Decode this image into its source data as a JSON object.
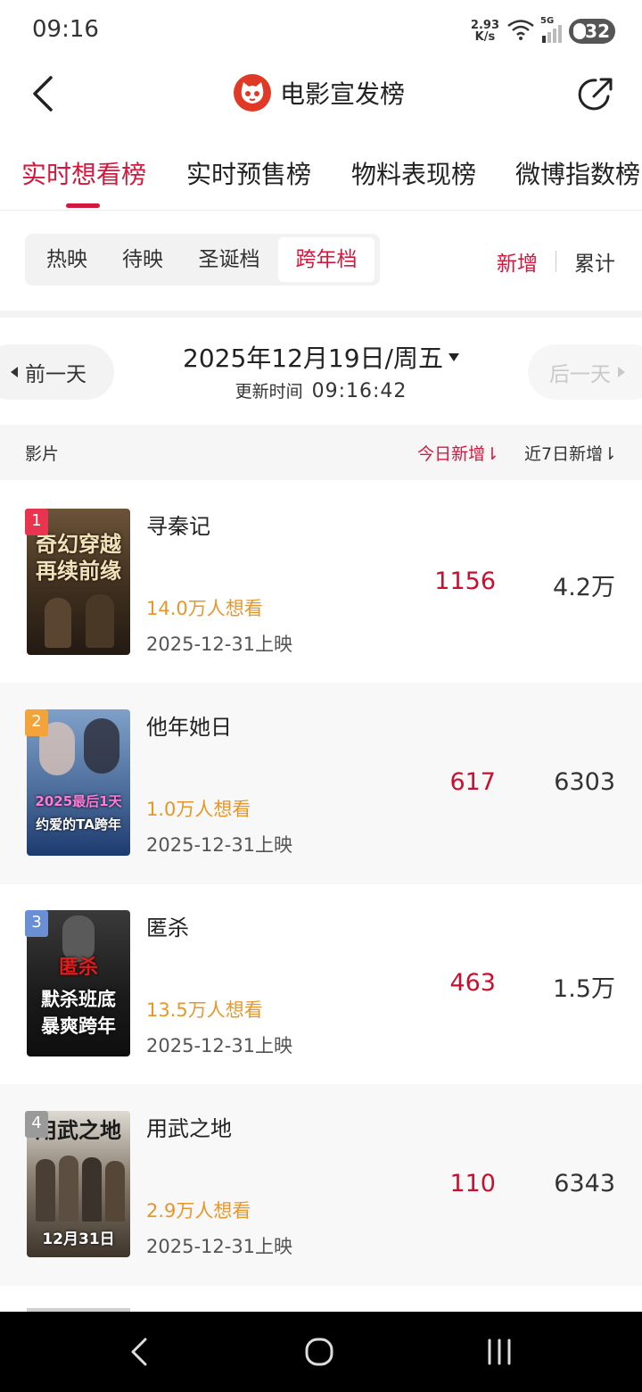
{
  "status": {
    "time": "09:16",
    "net_speed_value": "2.93",
    "net_speed_unit": "K/s",
    "signal_label": "5G",
    "battery": "32"
  },
  "header": {
    "title": "电影宣发榜"
  },
  "top_tabs": [
    {
      "label": "实时想看榜",
      "active": true
    },
    {
      "label": "实时预售榜",
      "active": false
    },
    {
      "label": "物料表现榜",
      "active": false
    },
    {
      "label": "微博指数榜",
      "active": false
    }
  ],
  "segments": [
    {
      "label": "热映",
      "active": false
    },
    {
      "label": "待映",
      "active": false
    },
    {
      "label": "圣诞档",
      "active": false
    },
    {
      "label": "跨年档",
      "active": true
    }
  ],
  "mode_toggle": {
    "new": "新增",
    "total": "累计"
  },
  "date_nav": {
    "prev": "前一天",
    "date": "2025年12月19日/周五",
    "next": "后一天",
    "update_label": "更新时间",
    "update_time": "09:16:42"
  },
  "table_header": {
    "film": "影片",
    "today": "今日新增⇂",
    "week": "近7日新增⇂"
  },
  "movies": [
    {
      "rank": "1",
      "title": "寻秦记",
      "want": "14.0万人想看",
      "release": "2025-12-31上映",
      "today": "1156",
      "week": "4.2万",
      "poster_lines": [
        "奇幻穿越",
        "再续前缘"
      ]
    },
    {
      "rank": "2",
      "title": "他年她日",
      "want": "1.0万人想看",
      "release": "2025-12-31上映",
      "today": "617",
      "week": "6303",
      "poster_lines": [
        "2025最后1天",
        "约爱的TA跨年"
      ]
    },
    {
      "rank": "3",
      "title": "匿杀",
      "want": "13.5万人想看",
      "release": "2025-12-31上映",
      "today": "463",
      "week": "1.5万",
      "poster_lines": [
        "匿杀",
        "默杀班底",
        "暴爽跨年"
      ]
    },
    {
      "rank": "4",
      "title": "用武之地",
      "want": "2.9万人想看",
      "release": "2025-12-31上映",
      "today": "110",
      "week": "6343",
      "poster_lines": [
        "用武之地",
        "12月31日"
      ]
    }
  ],
  "colors": {
    "accent": "#d4183d",
    "want": "#e8962a",
    "rank1": "#e8344e",
    "rank2": "#f2a33a",
    "rank3": "#6a8fd4",
    "rank4": "#9a9a9a"
  }
}
